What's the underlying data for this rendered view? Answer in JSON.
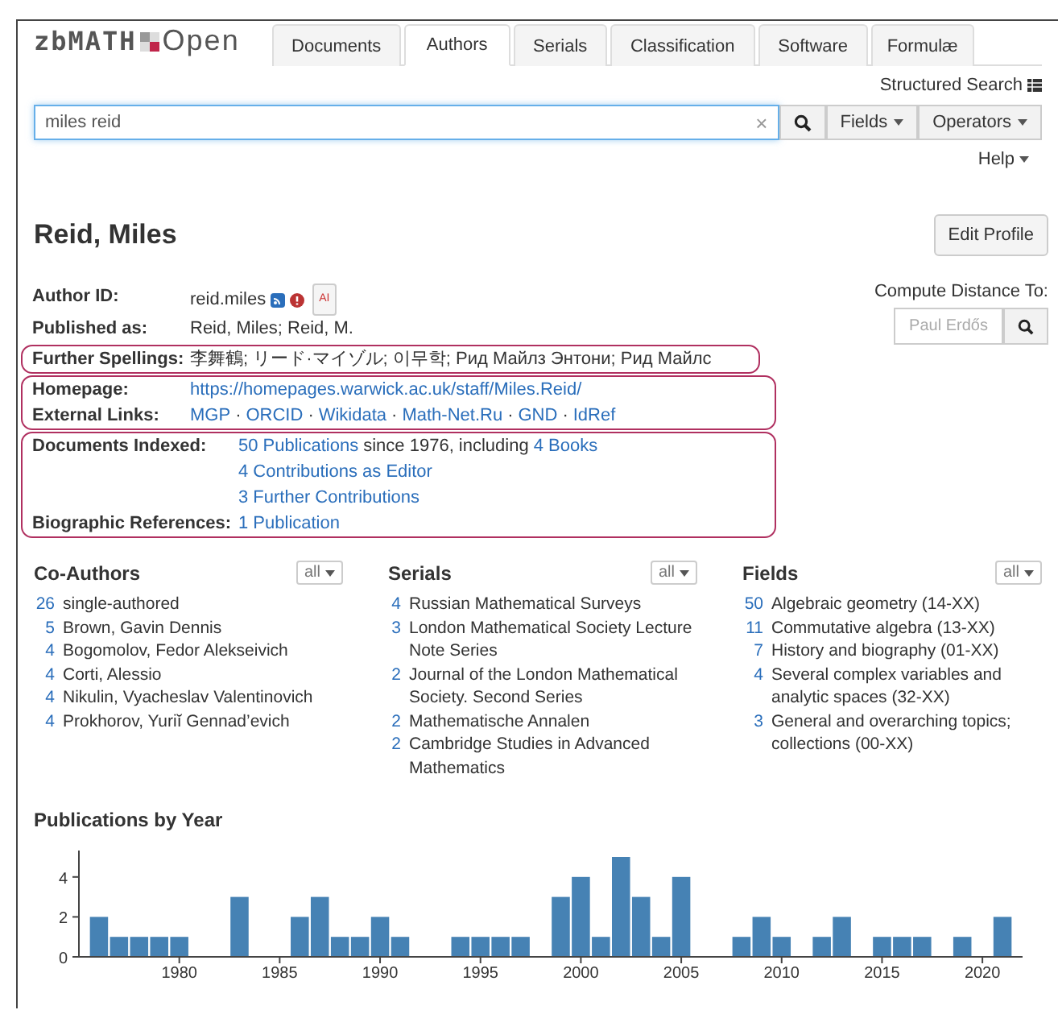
{
  "logo": {
    "name": "zbMATH",
    "suffix": "Open"
  },
  "tabs": [
    {
      "label": "Documents",
      "selected": false
    },
    {
      "label": "Authors",
      "selected": true
    },
    {
      "label": "Serials",
      "selected": false
    },
    {
      "label": "Classification",
      "selected": false
    },
    {
      "label": "Software",
      "selected": false
    },
    {
      "label": "Formulæ",
      "selected": false
    }
  ],
  "structured_search": "Structured Search",
  "search": {
    "value": "miles reid",
    "clear": "×",
    "fields": "Fields",
    "operators": "Operators"
  },
  "help": "Help",
  "author": {
    "name": "Reid, Miles",
    "edit_button": "Edit Profile"
  },
  "detail_groups": [
    {
      "highlighted": false,
      "rows": [
        {
          "label": "Author ID:",
          "lines": [
            [
              {
                "text": "reid.miles",
                "link": false
              }
            ]
          ],
          "badge": "AI"
        },
        {
          "label": "Published as:",
          "lines": [
            [
              {
                "text": "Reid, Miles; Reid, M.",
                "link": false
              }
            ]
          ]
        }
      ]
    },
    {
      "highlighted": true,
      "rows": [
        {
          "label": "Further Spellings:",
          "lines": [
            [
              {
                "text": "李舞鶴; リード·マイゾル; 이무학; Рид Майлз Энтони; Рид Майлс",
                "link": false
              }
            ]
          ]
        }
      ]
    },
    {
      "highlighted": true,
      "rows": [
        {
          "label": "Homepage:",
          "lines": [
            [
              {
                "text": "https://homepages.warwick.ac.uk/staff/Miles.Reid/",
                "link": true
              }
            ]
          ]
        },
        {
          "label": "External Links:",
          "lines": [
            [
              {
                "text": "MGP",
                "link": true
              },
              {
                "text": "·",
                "link": false
              },
              {
                "text": "ORCID",
                "link": true
              },
              {
                "text": "·",
                "link": false
              },
              {
                "text": "Wikidata",
                "link": true
              },
              {
                "text": "·",
                "link": false
              },
              {
                "text": "Math-Net.Ru",
                "link": true
              },
              {
                "text": "·",
                "link": false
              },
              {
                "text": "GND",
                "link": true
              },
              {
                "text": "·",
                "link": false
              },
              {
                "text": "IdRef",
                "link": true
              }
            ]
          ]
        }
      ]
    },
    {
      "highlighted": true,
      "rows": [
        {
          "label": "Documents Indexed:",
          "lines": [
            [
              {
                "text": "50 Publications",
                "link": true
              },
              {
                "text": "since 1976, including",
                "link": false
              },
              {
                "text": "4 Books",
                "link": true
              }
            ],
            [
              {
                "text": "4 Contributions as Editor",
                "link": true
              }
            ],
            [
              {
                "text": "3 Further Contributions",
                "link": true
              }
            ]
          ]
        },
        {
          "label": "Biographic References:",
          "lines": [
            [
              {
                "text": "1 Publication",
                "link": true
              }
            ]
          ]
        }
      ]
    }
  ],
  "compute_distance": {
    "label": "Compute Distance To:",
    "placeholder": "Paul Erdős"
  },
  "panels": [
    {
      "title": "Co-Authors",
      "filter": "all",
      "items": [
        {
          "count": "26",
          "label": "single-authored"
        },
        {
          "count": "5",
          "label": "Brown, Gavin Dennis"
        },
        {
          "count": "4",
          "label": "Bogomolov, Fedor Alekseivich"
        },
        {
          "count": "4",
          "label": "Corti, Alessio"
        },
        {
          "count": "4",
          "label": "Nikulin, Vyacheslav Valentinovich"
        },
        {
          "count": "4",
          "label": "Prokhorov, Yuriĭ Gennad’evich"
        }
      ]
    },
    {
      "title": "Serials",
      "filter": "all",
      "items": [
        {
          "count": "4",
          "label": "Russian Mathematical Surveys"
        },
        {
          "count": "3",
          "label": "London Mathematical Society Lecture Note Series"
        },
        {
          "count": "2",
          "label": "Journal of the London Mathematical Society. Second Series"
        },
        {
          "count": "2",
          "label": "Mathematische Annalen"
        },
        {
          "count": "2",
          "label": "Cambridge Studies in Advanced Mathematics"
        }
      ]
    },
    {
      "title": "Fields",
      "filter": "all",
      "items": [
        {
          "count": "50",
          "label": "Algebraic geometry (14-XX)"
        },
        {
          "count": "11",
          "label": "Commutative algebra (13-XX)"
        },
        {
          "count": "7",
          "label": "History and biography (01-XX)"
        },
        {
          "count": "4",
          "label": "Several complex variables and analytic spaces (32-XX)"
        },
        {
          "count": "3",
          "label": "General and overarching topics; collections (00-XX)"
        }
      ]
    }
  ],
  "publications_chart": {
    "chart_data": {
      "type": "bar",
      "title": "Publications by Year",
      "x": [
        1976,
        1977,
        1978,
        1979,
        1980,
        1983,
        1986,
        1987,
        1988,
        1989,
        1990,
        1991,
        1994,
        1995,
        1996,
        1997,
        1999,
        2000,
        2001,
        2002,
        2003,
        2004,
        2005,
        2008,
        2009,
        2010,
        2012,
        2013,
        2015,
        2016,
        2017,
        2019,
        2021
      ],
      "values": [
        2,
        1,
        1,
        1,
        1,
        3,
        2,
        3,
        1,
        1,
        2,
        1,
        1,
        1,
        1,
        1,
        3,
        4,
        1,
        5,
        3,
        1,
        4,
        1,
        2,
        1,
        1,
        2,
        1,
        1,
        1,
        1,
        2
      ],
      "xlim": [
        1975,
        2022
      ],
      "xticks": [
        1980,
        1985,
        1990,
        1995,
        2000,
        2005,
        2010,
        2015,
        2020
      ],
      "yticks": [
        0,
        2,
        4
      ],
      "ylim": [
        0,
        5
      ]
    }
  }
}
